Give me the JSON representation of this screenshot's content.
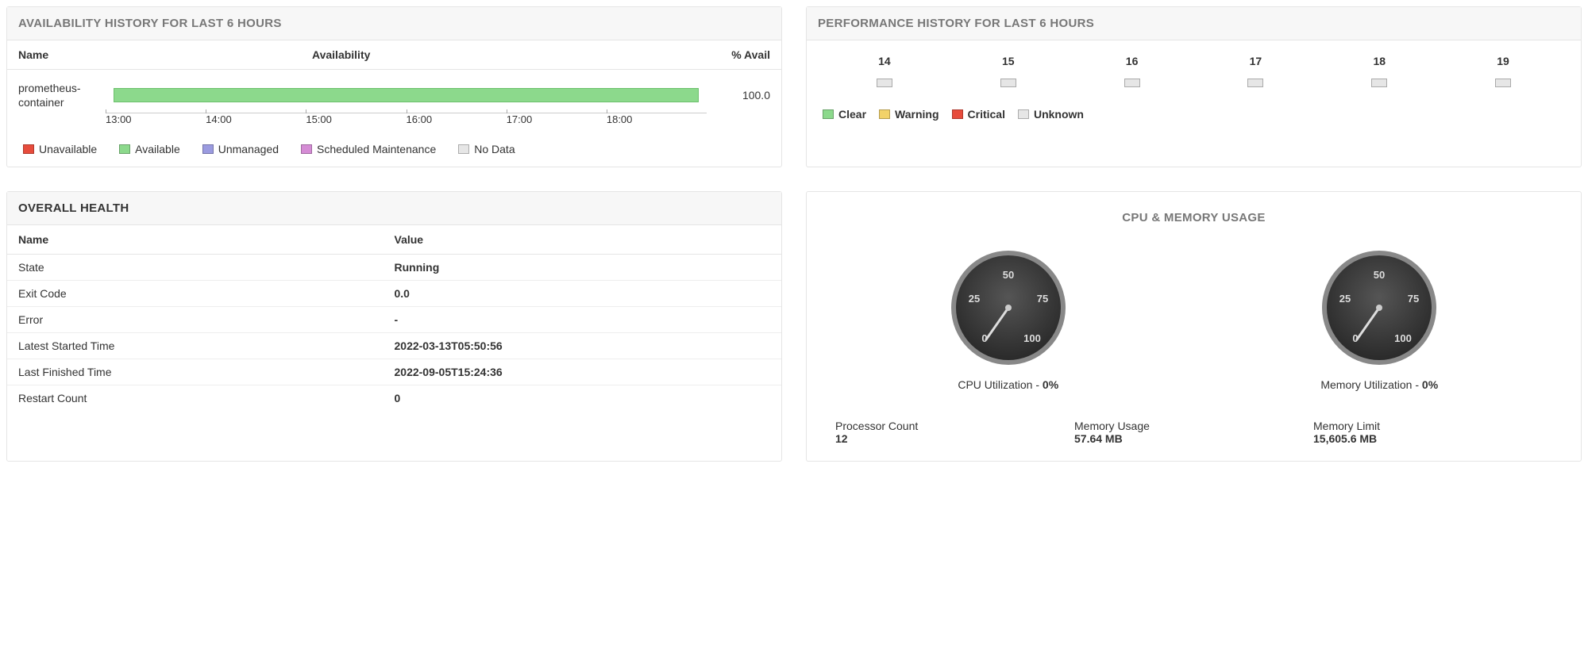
{
  "availability": {
    "title": "AVAILABILITY HISTORY FOR LAST 6 HOURS",
    "columns": {
      "name": "Name",
      "availability": "Availability",
      "pct": "% Avail"
    },
    "row": {
      "name": "prometheus-container",
      "pct": "100.0"
    },
    "axis": [
      "13:00",
      "14:00",
      "15:00",
      "16:00",
      "17:00",
      "18:00"
    ],
    "legend": [
      {
        "label": "Unavailable",
        "color": "#e74c3c"
      },
      {
        "label": "Available",
        "color": "#8cd98c"
      },
      {
        "label": "Unmanaged",
        "color": "#9b9be0"
      },
      {
        "label": "Scheduled Maintenance",
        "color": "#d58cd5"
      },
      {
        "label": "No Data",
        "color": "#e6e6e6"
      }
    ]
  },
  "performance": {
    "title": "PERFORMANCE HISTORY FOR LAST 6 HOURS",
    "hours": [
      "14",
      "15",
      "16",
      "17",
      "18",
      "19"
    ],
    "legend": [
      {
        "label": "Clear",
        "color": "#8cd98c"
      },
      {
        "label": "Warning",
        "color": "#f2d268"
      },
      {
        "label": "Critical",
        "color": "#e74c3c"
      },
      {
        "label": "Unknown",
        "color": "#e6e6e6"
      }
    ]
  },
  "health": {
    "title": "OVERALL HEALTH",
    "columns": {
      "name": "Name",
      "value": "Value"
    },
    "rows": [
      {
        "name": "State",
        "value": "Running"
      },
      {
        "name": "Exit Code",
        "value": "0.0"
      },
      {
        "name": "Error",
        "value": "-"
      },
      {
        "name": "Latest Started Time",
        "value": "2022-03-13T05:50:56"
      },
      {
        "name": "Last Finished Time",
        "value": "2022-09-05T15:24:36"
      },
      {
        "name": "Restart Count",
        "value": "0"
      }
    ]
  },
  "cpu": {
    "title": "CPU & MEMORY USAGE",
    "gauges": [
      {
        "label": "CPU Utilization - ",
        "value": "0%"
      },
      {
        "label": "Memory Utilization - ",
        "value": "0%"
      }
    ],
    "ticks": [
      "0",
      "25",
      "50",
      "75",
      "100"
    ],
    "stats": [
      {
        "label": "Processor Count",
        "value": "12"
      },
      {
        "label": "Memory Usage",
        "value": "57.64 MB"
      },
      {
        "label": "Memory Limit",
        "value": "15,605.6 MB"
      }
    ]
  },
  "chart_data": [
    {
      "type": "bar",
      "title": "Availability History for Last 6 Hours",
      "categories": [
        "prometheus-container"
      ],
      "values": [
        100.0
      ],
      "ylabel": "% Avail",
      "xlabel": "",
      "ylim": [
        0,
        100
      ],
      "time_axis": [
        "13:00",
        "14:00",
        "15:00",
        "16:00",
        "17:00",
        "18:00"
      ]
    },
    {
      "type": "table",
      "title": "Performance History for Last 6 Hours",
      "categories": [
        "14",
        "15",
        "16",
        "17",
        "18",
        "19"
      ],
      "values": [
        "Unknown",
        "Unknown",
        "Unknown",
        "Unknown",
        "Unknown",
        "Unknown"
      ]
    },
    {
      "type": "gauge",
      "title": "CPU Utilization",
      "value": 0,
      "range": [
        0,
        100
      ]
    },
    {
      "type": "gauge",
      "title": "Memory Utilization",
      "value": 0,
      "range": [
        0,
        100
      ]
    }
  ]
}
